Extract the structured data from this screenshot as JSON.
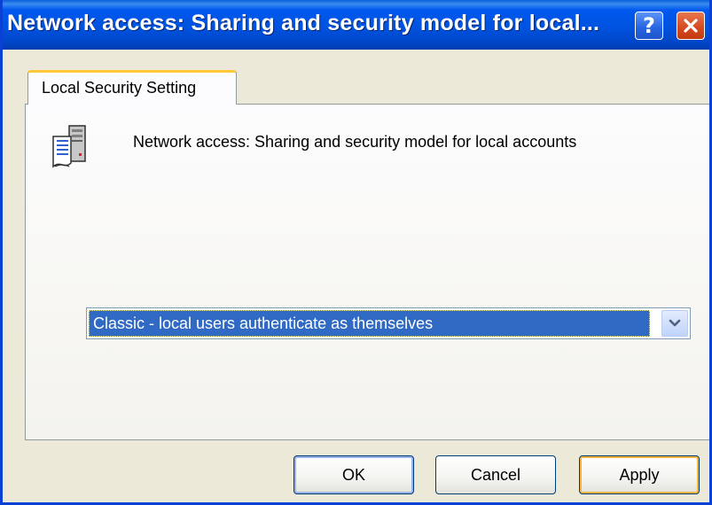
{
  "window": {
    "title": "Network access: Sharing and security model for local..."
  },
  "tab": {
    "label": "Local Security Setting"
  },
  "policy": {
    "description": "Network access: Sharing and security model for local accounts",
    "icon": "policy-server-icon"
  },
  "dropdown": {
    "selected": "Classic - local users authenticate as themselves"
  },
  "buttons": {
    "ok": "OK",
    "cancel": "Cancel",
    "apply": "Apply"
  },
  "colors": {
    "titlebar": "#0058ee",
    "selection": "#316ac5",
    "close": "#d44a1d"
  }
}
